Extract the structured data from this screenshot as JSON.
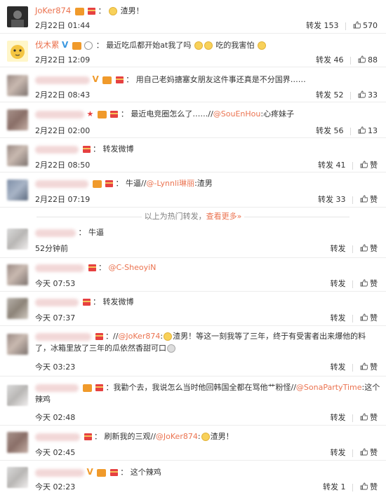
{
  "hot_notice": {
    "text": "以上为热门转发，",
    "more": "查看更多",
    "suffix": "»"
  },
  "comments": [
    {
      "name": "JoKer874",
      "text": "渣男！",
      "time": "2月22日 01:44",
      "repost_label": "转发",
      "repost_count": "153",
      "like_count": "570"
    },
    {
      "name": "伐木累",
      "text": "最近吃瓜都开始at我了吗",
      "text2": "吃的我害怕",
      "time": "2月22日 12:09",
      "repost_label": "转发",
      "repost_count": "46",
      "like_count": "88"
    },
    {
      "text": "用自己老妈搪塞女朋友这件事还真是不分国界……",
      "time": "2月22日 08:43",
      "repost_label": "转发",
      "repost_count": "52",
      "like_count": "33"
    },
    {
      "text": "最近电竞圈怎么了……//",
      "mention": "@SouEnHou",
      "text2": ":心疼妹子",
      "time": "2月22日 02:00",
      "repost_label": "转发",
      "repost_count": "56",
      "like_count": "13"
    },
    {
      "text": "转发微博",
      "time": "2月22日 08:50",
      "repost_label": "转发",
      "repost_count": "41",
      "like_label": "赞"
    },
    {
      "text": "牛逼//",
      "mention": "@-Lynnli琳丽",
      "text2": ":渣男",
      "time": "2月22日 07:19",
      "repost_label": "转发",
      "repost_count": "33",
      "like_label": "赞"
    },
    {
      "text": "牛逼",
      "time": "52分钟前",
      "repost_label": "转发",
      "like_label": "赞"
    },
    {
      "mention": "@C-SheoyiN",
      "time": "今天 07:53",
      "repost_label": "转发",
      "like_label": "赞"
    },
    {
      "text": "转发微博",
      "time": "今天 07:37",
      "repost_label": "转发",
      "like_label": "赞"
    },
    {
      "mention": "@JoKer874",
      "text": "渣男！等这一刻我等了三年，终于有受害者出来爆他的料",
      "text_line2": "了，冰箱里放了三年的瓜依然香甜可口",
      "time": "今天 03:23",
      "repost_label": "转发",
      "like_label": "赞"
    },
    {
      "text": "我勸个去，我说怎么当时他回韩国全都在骂他艹粉怪//",
      "mention": "@SonaPartyTime",
      "text2": ":这个",
      "text_line2": "辣鸡",
      "time": "今天 02:48",
      "repost_label": "转发",
      "like_label": "赞"
    },
    {
      "text": "刷新我的三观//",
      "mention": "@JoKer874",
      "text2": "渣男！",
      "time": "今天 02:45",
      "repost_label": "转发",
      "like_label": "赞"
    },
    {
      "text": "这个辣鸡",
      "time": "今天 02:23",
      "repost_label": "转发",
      "repost_count": "1",
      "like_label": "赞"
    }
  ]
}
